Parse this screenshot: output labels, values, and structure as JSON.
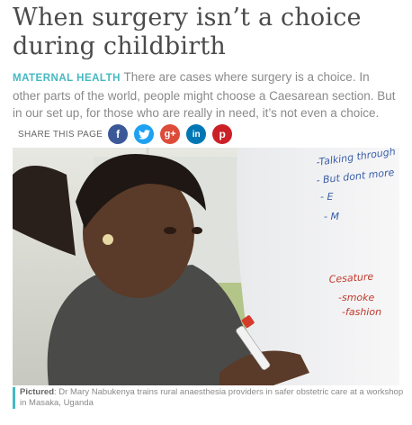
{
  "article": {
    "title": "When surgery isn’t a choice during childbirth",
    "category": "MATERNAL HEALTH",
    "lead": "There are cases where surgery is a choice. In other parts of the world, people might choose a Caesarean section. But in our set up, for those who are really in need, it’s not even a choice."
  },
  "share": {
    "label": "SHARE THIS PAGE",
    "buttons": [
      {
        "icon": "facebook-icon",
        "glyph": "f",
        "color": "#3b5998"
      },
      {
        "icon": "twitter-icon",
        "glyph": "t",
        "color": "#1da1f2"
      },
      {
        "icon": "google-plus-icon",
        "glyph": "g+",
        "color": "#dd4b39"
      },
      {
        "icon": "linkedin-icon",
        "glyph": "in",
        "color": "#0077b5"
      },
      {
        "icon": "pinterest-icon",
        "glyph": "p",
        "color": "#cb2027"
      }
    ]
  },
  "photo": {
    "board_text": [
      "-Talking through",
      "- But dont more",
      "- E",
      "- M",
      "Cesature",
      "-smoke",
      "-fashion"
    ]
  },
  "caption": {
    "label": "Pictured",
    "text": ": Dr Mary Nabukenya trains rural anaesthesia providers in safer obstetric care at a workshop in Masaka, Uganda"
  }
}
